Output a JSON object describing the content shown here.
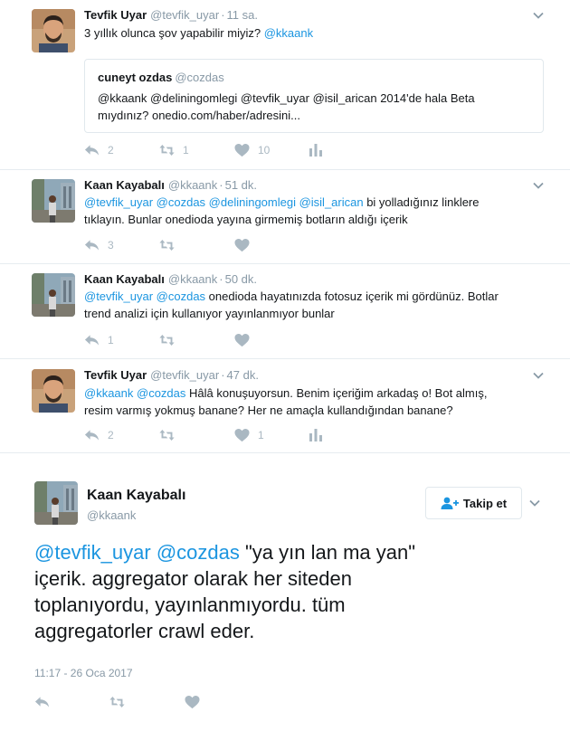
{
  "tweets": [
    {
      "name": "Tevfik Uyar",
      "handle": "@tevfik_uyar",
      "time": "11 sa.",
      "text_plain": "3 yıllık olunca şov yapabilir miyiz? ",
      "text_mention": "@kkaank",
      "quote": {
        "name": "cuneyt ozdas",
        "handle": "@cozdas",
        "line1": "@kkaank @deliningomlegi @tevfik_uyar @isil_arican 2014'de hala Beta",
        "line2": "mıydınız? onedio.com/haber/adresini..."
      },
      "replies": "2",
      "retweets": "1",
      "likes": "10"
    },
    {
      "name": "Kaan Kayabalı",
      "handle": "@kkaank",
      "time": "51 dk.",
      "mentions": "@tevfik_uyar @cozdas @deliningomlegi @isil_arican",
      "text_rest": " bi yolladığınız linklere",
      "text_line2": "tıklayın. Bunlar onedioda yayına girmemiş botların aldığı içerik",
      "replies": "3"
    },
    {
      "name": "Kaan Kayabalı",
      "handle": "@kkaank",
      "time": "50 dk.",
      "mentions": "@tevfik_uyar @cozdas",
      "text_rest": " onedioda hayatınızda fotosuz içerik mi gördünüz. Botlar",
      "text_line2": "trend analizi için kullanıyor yayınlanmıyor bunlar",
      "replies": "1"
    },
    {
      "name": "Tevfik Uyar",
      "handle": "@tevfik_uyar",
      "time": "47 dk.",
      "mentions": "@kkaank @cozdas",
      "text_rest": " Hâlâ konuşuyorsun. Benim içeriğim arkadaş o! Bot almış,",
      "text_line2": "resim varmış yokmuş banane? Her ne amaçla kullandığından banane?",
      "replies": "2",
      "likes": "1"
    }
  ],
  "focused": {
    "name": "Kaan Kayabalı",
    "handle": "@kkaank",
    "follow_label": "Takip et",
    "mentions": "@tevfik_uyar @cozdas",
    "line1_rest": " \"ya yın lan ma yan\"",
    "line2": "içerik. aggregator olarak her siteden",
    "line3": "toplanıyordu, yayınlanmıyordu. tüm",
    "line4": "aggregatorler crawl eder.",
    "timestamp": "11:17 - 26 Oca 2017"
  },
  "colors": {
    "link": "#1b95e0",
    "muted": "#8899a6",
    "icon": "#aab8c2",
    "border": "#e6ecf0"
  },
  "icons": [
    "reply-icon",
    "retweet-icon",
    "like-icon",
    "stats-icon",
    "chevron-down-icon",
    "follow-user-icon"
  ]
}
